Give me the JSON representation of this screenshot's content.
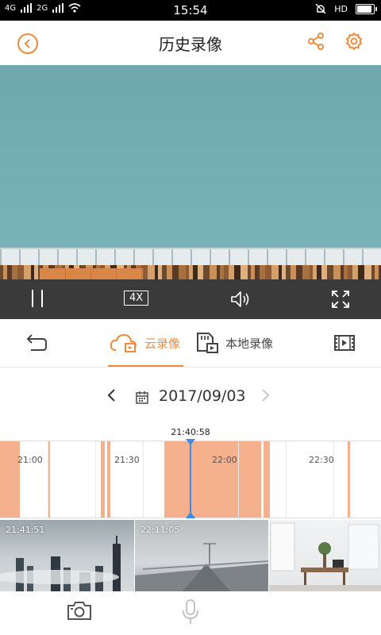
{
  "status_bar": {
    "signal_1": "4G",
    "signal_2": "2G",
    "time": "15:54",
    "network": "HD"
  },
  "header": {
    "title": "历史录像"
  },
  "player": {
    "speed_label": "4X"
  },
  "tabs": [
    {
      "label": "云录像",
      "active": true
    },
    {
      "label": "本地录像",
      "active": false
    }
  ],
  "date_nav": {
    "date": "2017/09/03"
  },
  "timeline": {
    "current_time": "21:40:58",
    "ticks": [
      "21:00",
      "21:30",
      "22:00",
      "22:30"
    ]
  },
  "thumbnails": [
    {
      "timestamp": "21:41:51"
    },
    {
      "timestamp": "22:11:05"
    },
    {
      "timestamp": ""
    }
  ],
  "colors": {
    "accent": "#f08a3c",
    "recorded": "#f5b08d",
    "cursor": "#3a8ee6"
  }
}
